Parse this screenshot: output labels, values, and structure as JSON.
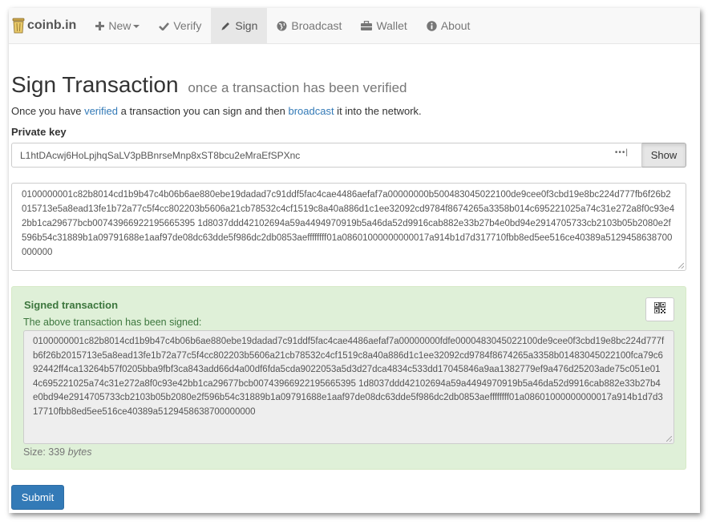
{
  "nav": {
    "brand": "coinb.in",
    "items": [
      {
        "label": "New",
        "icon": "plus-icon"
      },
      {
        "label": "Verify",
        "icon": "check-icon"
      },
      {
        "label": "Sign",
        "icon": "pencil-icon"
      },
      {
        "label": "Broadcast",
        "icon": "globe-icon"
      },
      {
        "label": "Wallet",
        "icon": "briefcase-icon"
      },
      {
        "label": "About",
        "icon": "info-icon"
      }
    ],
    "active": "Sign"
  },
  "page": {
    "title": "Sign Transaction",
    "subtitle": "once a transaction has been verified",
    "lead_prefix": "Once you have ",
    "lead_link1": "verified",
    "lead_middle": " a transaction you can sign and then ",
    "lead_link2": "broadcast",
    "lead_suffix": " it into the network."
  },
  "private_key": {
    "label": "Private key",
    "value": "L1htDAcwj6HoLpjhqSaLV3pBBnrseMnp8xST8bcu2eMraEfSPXnc",
    "show_label": "Show"
  },
  "transaction_input": "0100000001c82b8014cd1b9b47c4b06b6ae880ebe19dadad7c91ddf5fac4cae4486aefaf7a00000000b500483045022100de9cee0f3cbd19e8bc224d777fb6f26b2015713e5a8ead13fe1b72a77c5f4cc802203b5606a21cb78532c4cf1519c8a40a886d1c1ee32092cd9784f8674265a3358b014c695221025a74c31e272a8f0c93e42bb1ca29677bcb00743966922195665395 1d8037ddd42102694a59a4494970919b5a46da52d9916cab882e33b27b4e0bd94e2914705733cb2103b05b2080e2f596b54c31889b1a09791688e1aaf97de08dc63dde5f986dc2db0853aeffffffff01a08601000000000017a914b1d7d317710fbb8ed5ee516ce40389a5129458638700000000",
  "signed": {
    "title": "Signed transaction",
    "message": "The above transaction has been signed:",
    "value": "0100000001c82b8014cd1b9b47c4b06b6ae880ebe19dadad7c91ddf5fac4cae4486aefaf7a00000000fdfe0000483045022100de9cee0f3cbd19e8bc224d777fb6f26b2015713e5a8ead13fe1b72a77c5f4cc802203b5606a21cb78532c4cf1519c8a40a886d1c1ee32092cd9784f8674265a3358b01483045022100fca79c692442ff4ca13264b57f0205bba9fbf3ca843add66d4a00df6fda5cda9022053a5d3d27dca4834c533dd17045846a9aa1382779ef9a476d25203ade75c051e014c695221025a74c31e272a8f0c93e42bb1ca29677bcb00743966922195665395 1d8037ddd42102694a59a4494970919b5a46da52d9916cab882e33b27b4e0bd94e2914705733cb2103b05b2080e2f596b54c31889b1a09791688e1aaf97de08dc63dde5f986dc2db0853aeffffffff01a08601000000000017a914b1d7d317710fbb8ed5ee516ce40389a5129458638700000000",
    "size_prefix": "Size: 339 ",
    "size_unit": "bytes"
  },
  "submit_label": "Submit"
}
